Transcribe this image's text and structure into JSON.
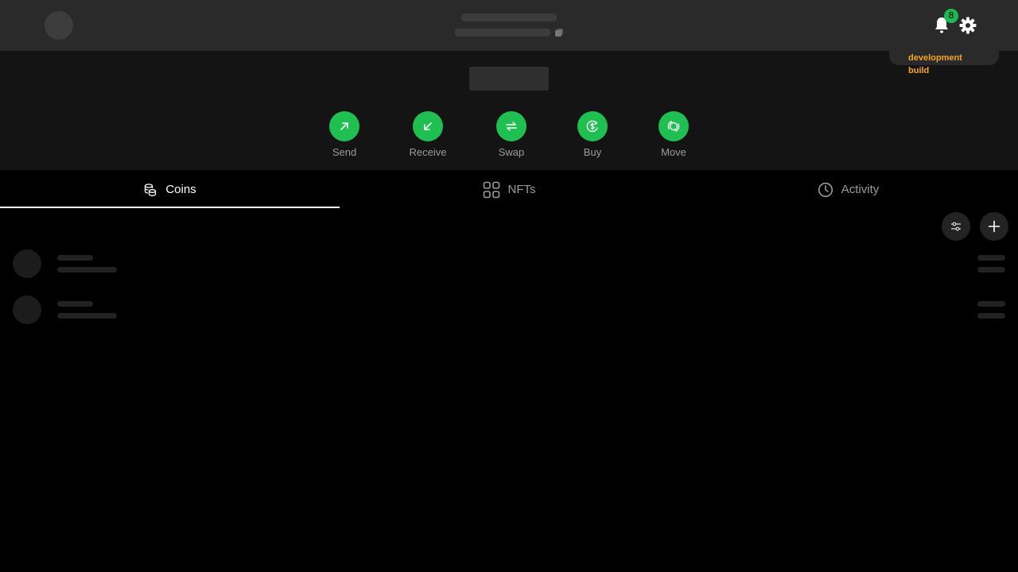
{
  "header": {
    "notification_count": "8",
    "icons": [
      "avatar",
      "copy-icon",
      "bell-icon",
      "gear-icon"
    ]
  },
  "dev_banner": {
    "line1": "development",
    "line2": "build",
    "color": "#f5a623"
  },
  "actions": [
    {
      "label": "Send",
      "icon": "arrow-up-right-icon"
    },
    {
      "label": "Receive",
      "icon": "arrow-down-left-icon"
    },
    {
      "label": "Swap",
      "icon": "swap-arrows-icon"
    },
    {
      "label": "Buy",
      "icon": "buy-dollar-icon"
    },
    {
      "label": "Move",
      "icon": "move-icon"
    }
  ],
  "tabs": [
    {
      "label": "Coins",
      "icon": "coins-icon",
      "active": true
    },
    {
      "label": "NFTs",
      "icon": "grid-icon",
      "active": false
    },
    {
      "label": "Activity",
      "icon": "clock-icon",
      "active": false
    }
  ],
  "tools": [
    "filter-icon",
    "plus-icon"
  ],
  "colors": {
    "accent": "#1fbf52",
    "header_bg": "#2a2a2a",
    "balance_bg": "#141414",
    "page_bg": "#000000"
  }
}
